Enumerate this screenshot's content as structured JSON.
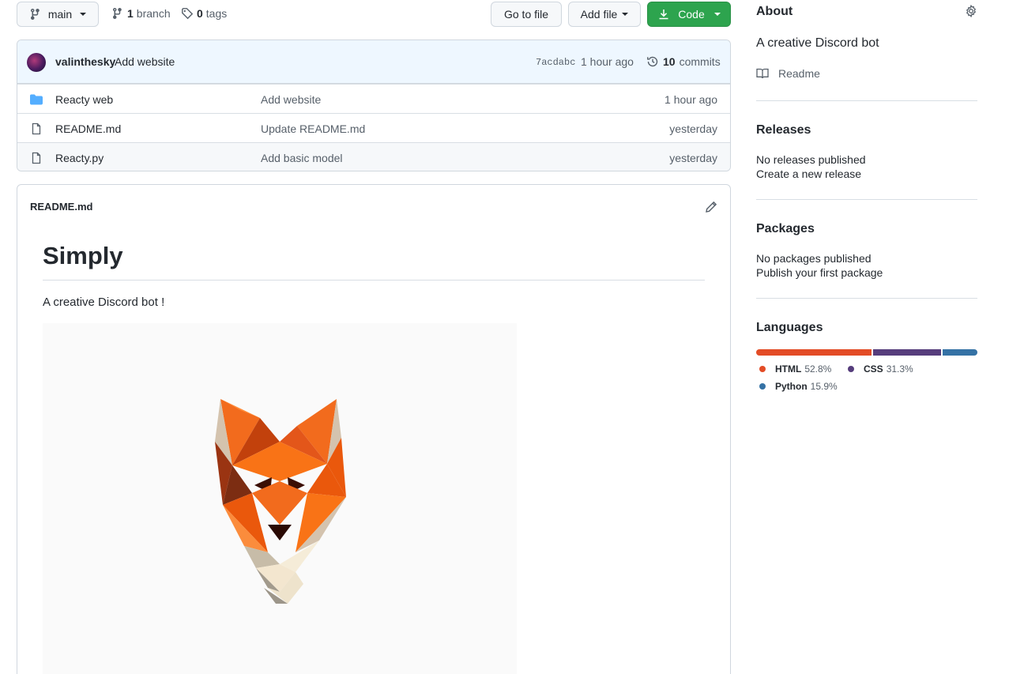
{
  "toolbar": {
    "branch_button": "main",
    "branch_count": "1",
    "branch_word": "branch",
    "tag_count": "0",
    "tag_word": "tags",
    "go_to_file": "Go to file",
    "add_file": "Add file",
    "code": "Code"
  },
  "commit": {
    "author": "valinthesky",
    "message": "Add website",
    "sha": "7acdabc",
    "time": "1 hour ago",
    "count": "10",
    "count_word": "commits"
  },
  "files": [
    {
      "name": "Reacty web",
      "message": "Add website",
      "time": "1 hour ago",
      "icon": "folder-icon"
    },
    {
      "name": "README.md",
      "message": "Update README.md",
      "time": "yesterday",
      "icon": "file-icon"
    },
    {
      "name": "Reacty.py",
      "message": "Add basic model",
      "time": "yesterday",
      "icon": "file-icon"
    }
  ],
  "readme": {
    "file_title": "README.md",
    "heading": "Simply",
    "body": "A creative Discord bot !"
  },
  "about": {
    "title": "About",
    "description": "A creative Discord bot",
    "readme_link": "Readme"
  },
  "releases": {
    "title": "Releases",
    "status": "No releases published",
    "link": "Create a new release"
  },
  "packages": {
    "title": "Packages",
    "status": "No packages published",
    "link": "Publish your first package"
  },
  "languages": {
    "title": "Languages",
    "items": [
      {
        "name": "HTML",
        "percent": "52.8%",
        "value": 52.8,
        "color": "#e34c26"
      },
      {
        "name": "CSS",
        "percent": "31.3%",
        "value": 31.3,
        "color": "#563d7c"
      },
      {
        "name": "Python",
        "percent": "15.9%",
        "value": 15.9,
        "color": "#3572a5"
      }
    ]
  },
  "colors": {
    "accent_link": "#0969da",
    "primary_button": "#2da44e"
  }
}
